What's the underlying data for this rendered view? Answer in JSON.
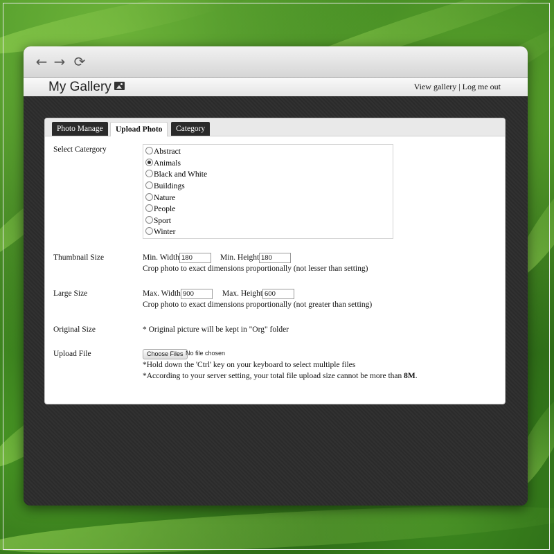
{
  "browser": {
    "back_icon": "←",
    "forward_icon": "→",
    "reload_icon": "⟳"
  },
  "header": {
    "title": "My Gallery",
    "links": {
      "view_gallery": "View gallery",
      "separator": "|",
      "logout": "Log me out"
    }
  },
  "tabs": [
    {
      "label": "Photo Manage",
      "active": false
    },
    {
      "label": "Upload Photo",
      "active": true
    },
    {
      "label": "Category",
      "active": false
    }
  ],
  "form": {
    "category": {
      "label": "Select Catergory",
      "options": [
        "Abstract",
        "Animals",
        "Black and White",
        "Buildings",
        "Nature",
        "People",
        "Sport",
        "Winter"
      ],
      "selected": "Animals"
    },
    "thumbnail": {
      "label": "Thumbnail Size",
      "width_label": "Min. Width",
      "width_value": "180",
      "height_label": "Min. Height",
      "height_value": "180",
      "note": "Crop photo to exact dimensions proportionally (not lesser than setting)"
    },
    "large": {
      "label": "Large Size",
      "width_label": "Max. Width",
      "width_value": "900",
      "height_label": "Max. Height",
      "height_value": "600",
      "note": "Crop photo to exact dimensions proportionally (not greater than setting)"
    },
    "original": {
      "label": "Original Size",
      "note": "* Original picture will be kept in \"Org\" folder"
    },
    "upload": {
      "label": "Upload File",
      "button_label": "Choose Files",
      "status": "No file chosen",
      "hint1": "*Hold down the 'Ctrl' key on your keyboard to select multiple files",
      "hint2": "*According to your server setting, your total file upload size cannot be more than",
      "limit": "8M",
      "period": "."
    }
  }
}
